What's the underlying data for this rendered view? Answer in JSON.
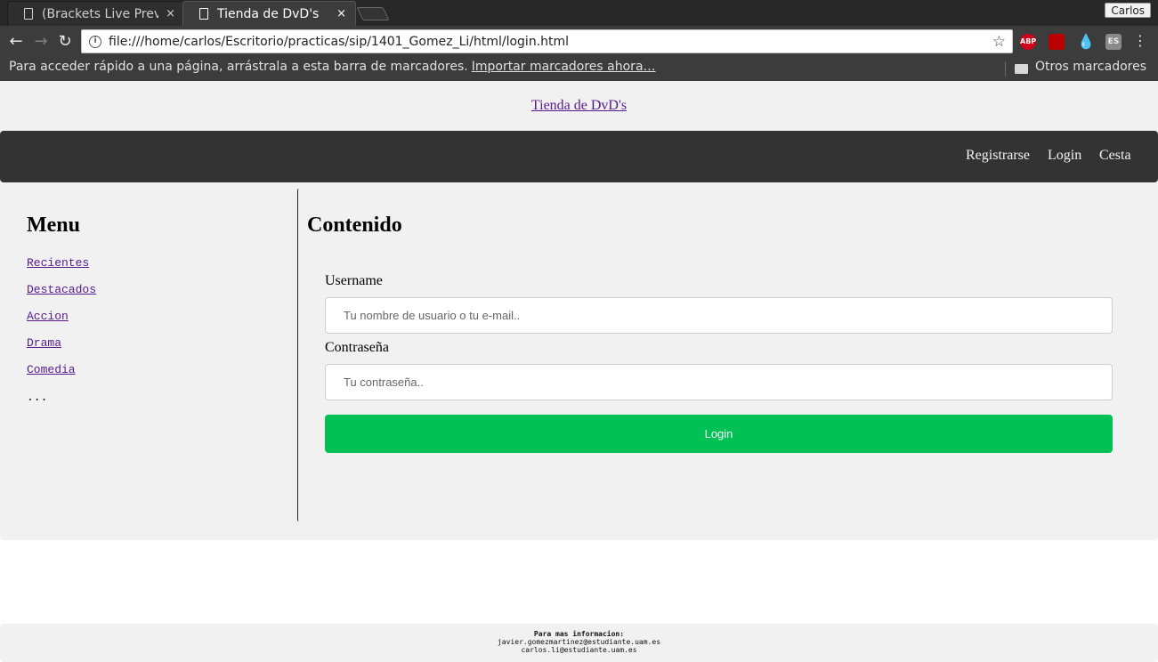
{
  "browser": {
    "tabs": [
      {
        "title": "(Brackets Live Prev",
        "close": "×",
        "active": false
      },
      {
        "title": "Tienda de DvD's",
        "close": "×",
        "active": true
      }
    ],
    "profile_name": "Carlos",
    "url": "file:///home/carlos/Escritorio/practicas/sip/1401_Gomez_Li/html/login.html",
    "extensions": [
      "ABP",
      "",
      "",
      "ES"
    ],
    "bookmarks_bar": {
      "hint": "Para acceder rápido a una página, arrástrala a esta barra de marcadores.",
      "import_link": "Importar marcadores ahora…",
      "other_bookmarks": "Otros marcadores"
    }
  },
  "page": {
    "site_title": "Tienda de DvD's",
    "nav": [
      "Registrarse",
      "Login",
      "Cesta"
    ],
    "sidebar": {
      "heading": "Menu",
      "links": [
        "Recientes",
        "Destacados",
        "Accion",
        "Drama",
        "Comedia"
      ],
      "more": "..."
    },
    "content": {
      "heading": "Contenido",
      "username_label": "Username",
      "username_placeholder": "Tu nombre de usuario o tu e-mail..",
      "password_label": "Contraseña",
      "password_placeholder": "Tu contraseña..",
      "login_button": "Login"
    },
    "footer": {
      "title": "Para mas informacion:",
      "emails": [
        "javier.gomezmartinez@estudiante.uam.es",
        "carlos.li@estudiante.uam.es"
      ]
    }
  },
  "colors": {
    "nav_bg": "#333333",
    "page_bg": "#f1f1f1",
    "login_button": "#00c153",
    "link_visited": "#551a8b"
  }
}
